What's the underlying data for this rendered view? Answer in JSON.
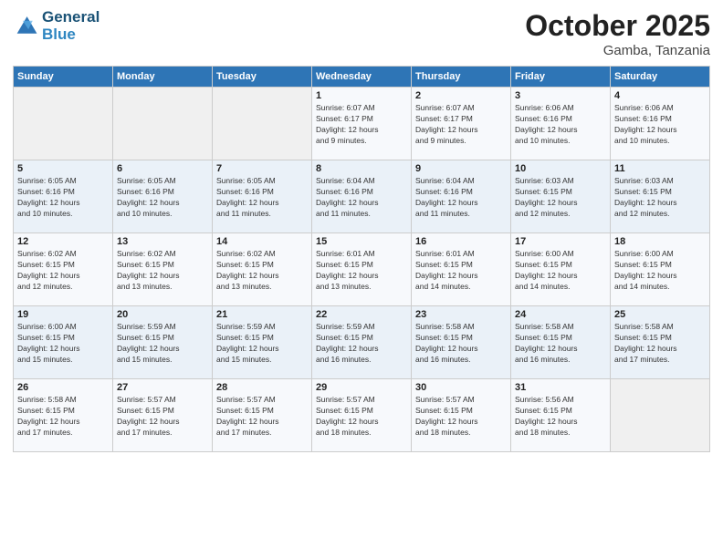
{
  "header": {
    "logo_line1": "General",
    "logo_line2": "Blue",
    "month": "October 2025",
    "location": "Gamba, Tanzania"
  },
  "weekdays": [
    "Sunday",
    "Monday",
    "Tuesday",
    "Wednesday",
    "Thursday",
    "Friday",
    "Saturday"
  ],
  "weeks": [
    [
      {
        "day": "",
        "info": ""
      },
      {
        "day": "",
        "info": ""
      },
      {
        "day": "",
        "info": ""
      },
      {
        "day": "1",
        "info": "Sunrise: 6:07 AM\nSunset: 6:17 PM\nDaylight: 12 hours\nand 9 minutes."
      },
      {
        "day": "2",
        "info": "Sunrise: 6:07 AM\nSunset: 6:17 PM\nDaylight: 12 hours\nand 9 minutes."
      },
      {
        "day": "3",
        "info": "Sunrise: 6:06 AM\nSunset: 6:16 PM\nDaylight: 12 hours\nand 10 minutes."
      },
      {
        "day": "4",
        "info": "Sunrise: 6:06 AM\nSunset: 6:16 PM\nDaylight: 12 hours\nand 10 minutes."
      }
    ],
    [
      {
        "day": "5",
        "info": "Sunrise: 6:05 AM\nSunset: 6:16 PM\nDaylight: 12 hours\nand 10 minutes."
      },
      {
        "day": "6",
        "info": "Sunrise: 6:05 AM\nSunset: 6:16 PM\nDaylight: 12 hours\nand 10 minutes."
      },
      {
        "day": "7",
        "info": "Sunrise: 6:05 AM\nSunset: 6:16 PM\nDaylight: 12 hours\nand 11 minutes."
      },
      {
        "day": "8",
        "info": "Sunrise: 6:04 AM\nSunset: 6:16 PM\nDaylight: 12 hours\nand 11 minutes."
      },
      {
        "day": "9",
        "info": "Sunrise: 6:04 AM\nSunset: 6:16 PM\nDaylight: 12 hours\nand 11 minutes."
      },
      {
        "day": "10",
        "info": "Sunrise: 6:03 AM\nSunset: 6:15 PM\nDaylight: 12 hours\nand 12 minutes."
      },
      {
        "day": "11",
        "info": "Sunrise: 6:03 AM\nSunset: 6:15 PM\nDaylight: 12 hours\nand 12 minutes."
      }
    ],
    [
      {
        "day": "12",
        "info": "Sunrise: 6:02 AM\nSunset: 6:15 PM\nDaylight: 12 hours\nand 12 minutes."
      },
      {
        "day": "13",
        "info": "Sunrise: 6:02 AM\nSunset: 6:15 PM\nDaylight: 12 hours\nand 13 minutes."
      },
      {
        "day": "14",
        "info": "Sunrise: 6:02 AM\nSunset: 6:15 PM\nDaylight: 12 hours\nand 13 minutes."
      },
      {
        "day": "15",
        "info": "Sunrise: 6:01 AM\nSunset: 6:15 PM\nDaylight: 12 hours\nand 13 minutes."
      },
      {
        "day": "16",
        "info": "Sunrise: 6:01 AM\nSunset: 6:15 PM\nDaylight: 12 hours\nand 14 minutes."
      },
      {
        "day": "17",
        "info": "Sunrise: 6:00 AM\nSunset: 6:15 PM\nDaylight: 12 hours\nand 14 minutes."
      },
      {
        "day": "18",
        "info": "Sunrise: 6:00 AM\nSunset: 6:15 PM\nDaylight: 12 hours\nand 14 minutes."
      }
    ],
    [
      {
        "day": "19",
        "info": "Sunrise: 6:00 AM\nSunset: 6:15 PM\nDaylight: 12 hours\nand 15 minutes."
      },
      {
        "day": "20",
        "info": "Sunrise: 5:59 AM\nSunset: 6:15 PM\nDaylight: 12 hours\nand 15 minutes."
      },
      {
        "day": "21",
        "info": "Sunrise: 5:59 AM\nSunset: 6:15 PM\nDaylight: 12 hours\nand 15 minutes."
      },
      {
        "day": "22",
        "info": "Sunrise: 5:59 AM\nSunset: 6:15 PM\nDaylight: 12 hours\nand 16 minutes."
      },
      {
        "day": "23",
        "info": "Sunrise: 5:58 AM\nSunset: 6:15 PM\nDaylight: 12 hours\nand 16 minutes."
      },
      {
        "day": "24",
        "info": "Sunrise: 5:58 AM\nSunset: 6:15 PM\nDaylight: 12 hours\nand 16 minutes."
      },
      {
        "day": "25",
        "info": "Sunrise: 5:58 AM\nSunset: 6:15 PM\nDaylight: 12 hours\nand 17 minutes."
      }
    ],
    [
      {
        "day": "26",
        "info": "Sunrise: 5:58 AM\nSunset: 6:15 PM\nDaylight: 12 hours\nand 17 minutes."
      },
      {
        "day": "27",
        "info": "Sunrise: 5:57 AM\nSunset: 6:15 PM\nDaylight: 12 hours\nand 17 minutes."
      },
      {
        "day": "28",
        "info": "Sunrise: 5:57 AM\nSunset: 6:15 PM\nDaylight: 12 hours\nand 17 minutes."
      },
      {
        "day": "29",
        "info": "Sunrise: 5:57 AM\nSunset: 6:15 PM\nDaylight: 12 hours\nand 18 minutes."
      },
      {
        "day": "30",
        "info": "Sunrise: 5:57 AM\nSunset: 6:15 PM\nDaylight: 12 hours\nand 18 minutes."
      },
      {
        "day": "31",
        "info": "Sunrise: 5:56 AM\nSunset: 6:15 PM\nDaylight: 12 hours\nand 18 minutes."
      },
      {
        "day": "",
        "info": ""
      }
    ]
  ]
}
